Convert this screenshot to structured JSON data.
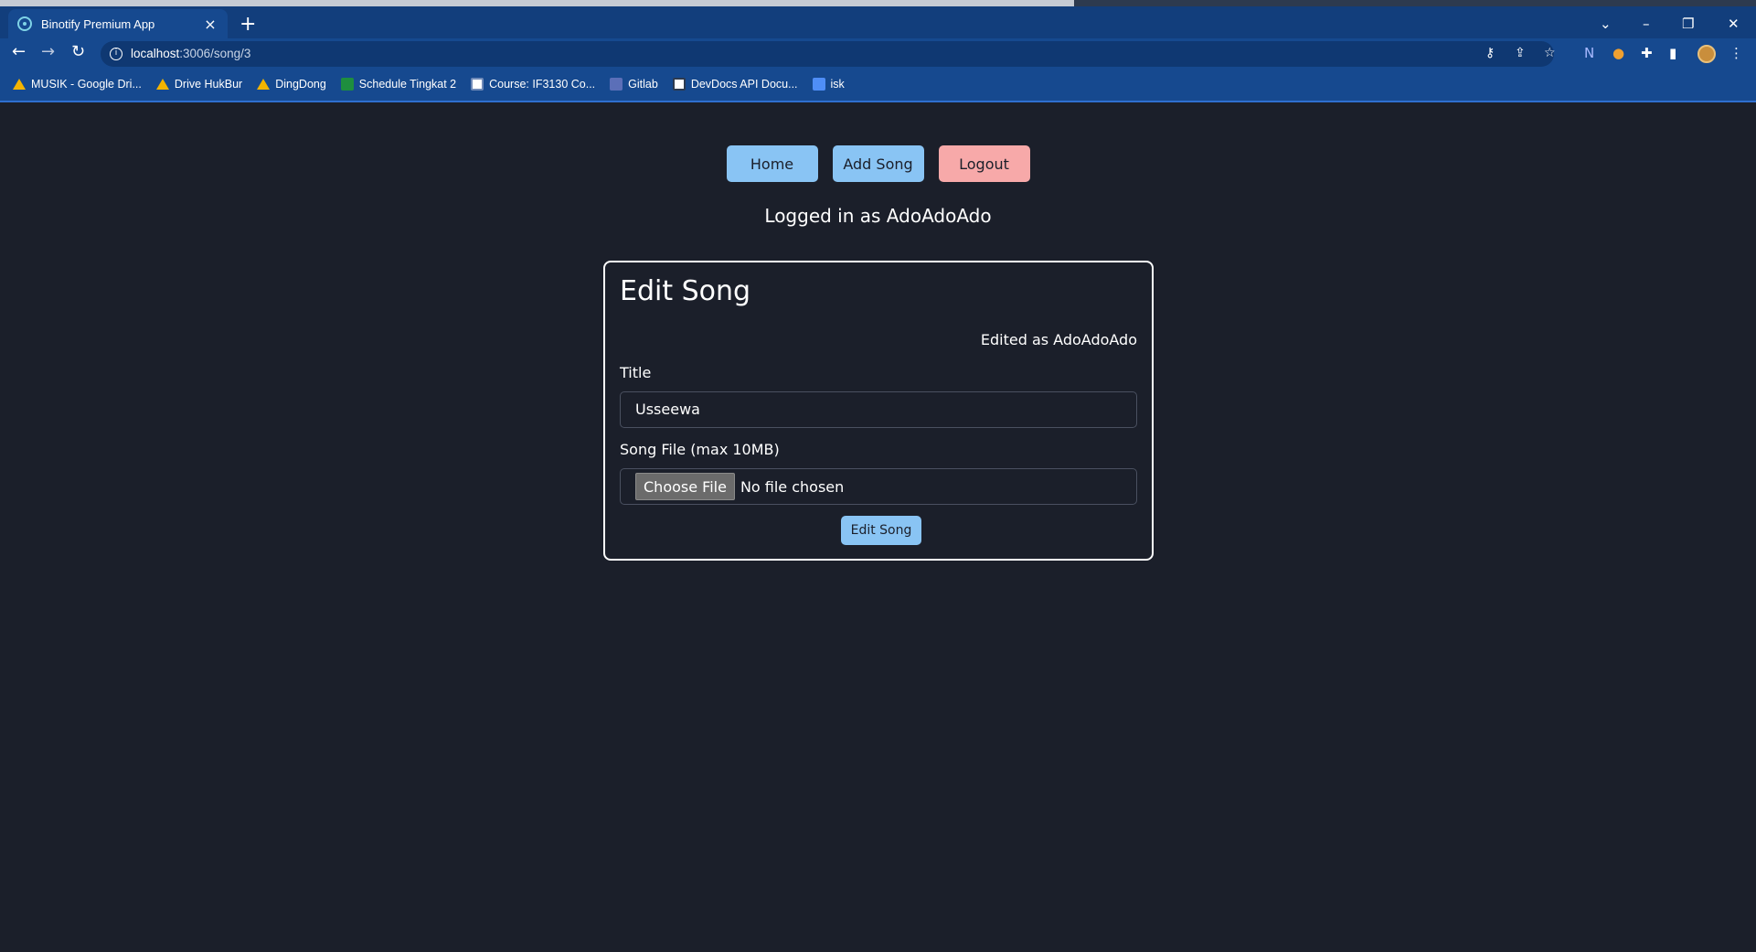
{
  "browser": {
    "tab_title": "Binotify Premium App",
    "tab_close": "×",
    "new_tab": "+",
    "url_host": "localhost",
    "url_path": ":3006/song/3",
    "bookmarks": [
      {
        "label": "MUSIK - Google Dri...",
        "icon": "drive-icon"
      },
      {
        "label": "Drive HukBur",
        "icon": "drive-icon"
      },
      {
        "label": "DingDong",
        "icon": "drive-icon"
      },
      {
        "label": "Schedule Tingkat 2",
        "icon": "sheets-icon"
      },
      {
        "label": "Course: IF3130 Co...",
        "icon": "course-icon"
      },
      {
        "label": "Gitlab",
        "icon": "gitlab-icon"
      },
      {
        "label": "DevDocs API Docu...",
        "icon": "devdocs-icon"
      },
      {
        "label": "isk",
        "icon": "docs-icon"
      }
    ]
  },
  "nav": {
    "home_label": "Home",
    "add_song_label": "Add Song",
    "logout_label": "Logout"
  },
  "status": {
    "logged_in_text": "Logged in as AdoAdoAdo"
  },
  "form": {
    "heading": "Edit Song",
    "edited_as": "Edited as AdoAdoAdo",
    "title_label": "Title",
    "title_value": "Usseewa",
    "file_label": "Song File (max 10MB)",
    "choose_file_label": "Choose File",
    "no_file_text": "No file chosen",
    "submit_label": "Edit Song"
  },
  "colors": {
    "page_background": "#1b1f2a",
    "primary_button": "#89c4f4",
    "logout_button": "#f7a9a9",
    "browser_chrome": "#16498f"
  }
}
